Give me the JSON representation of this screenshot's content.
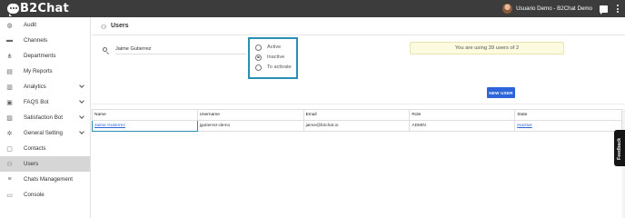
{
  "topbar": {
    "logo_text": "B2Chat",
    "user_name": "Usuario Demo - B2Chat Demo"
  },
  "sidebar": {
    "items": [
      {
        "label": "Audit",
        "icon": "check-circle-icon",
        "glyph": "◍",
        "chevron": false
      },
      {
        "label": "Channels",
        "icon": "chat-bubbles-icon",
        "glyph": "▬",
        "chevron": false
      },
      {
        "label": "Departments",
        "icon": "hierarchy-icon",
        "glyph": "⋔",
        "chevron": false
      },
      {
        "label": "My Reports",
        "icon": "report-icon",
        "glyph": "▤",
        "chevron": false
      },
      {
        "label": "Analytics",
        "icon": "bar-chart-icon",
        "glyph": "▥",
        "chevron": true
      },
      {
        "label": "FAQS Bot",
        "icon": "faq-icon",
        "glyph": "▣",
        "chevron": true
      },
      {
        "label": "Satisfaction Bot",
        "icon": "satisfaction-icon",
        "glyph": "▨",
        "chevron": true
      },
      {
        "label": "General Setting",
        "icon": "gear-icon",
        "glyph": "✲",
        "chevron": true
      },
      {
        "label": "Contacts",
        "icon": "contacts-icon",
        "glyph": "▢",
        "chevron": false
      },
      {
        "label": "Users",
        "icon": "users-icon",
        "glyph": "⚇",
        "chevron": false
      },
      {
        "label": "Chats Management",
        "icon": "chats-management-icon",
        "glyph": "≡",
        "chevron": false
      },
      {
        "label": "Console",
        "icon": "console-icon",
        "glyph": "▭",
        "chevron": false
      }
    ],
    "active": "Users"
  },
  "page": {
    "title": "Users"
  },
  "filters": {
    "search_value": "Jaime Gutierrez",
    "status_options": [
      {
        "label": "Active",
        "checked": false
      },
      {
        "label": "Inactive",
        "checked": true
      },
      {
        "label": "To activate",
        "checked": false
      }
    ]
  },
  "usage": {
    "text": "You are using 39 users of 2"
  },
  "actions": {
    "new_user_label": "NEW USER"
  },
  "table": {
    "columns": [
      "Name",
      "Username",
      "Email",
      "Role",
      "State"
    ],
    "rows": [
      [
        "Jaime Gutierrez",
        "jgutierrez-demo",
        "jaime@b2chat.io",
        "ADMIN",
        "Inactive"
      ]
    ]
  },
  "feedback": {
    "label": "Feedback"
  },
  "colors": {
    "topbar": "#3c3c3c",
    "accent_blue": "#2e64d9",
    "highlight_border": "#2a8fb5",
    "active_nav": "#d6d6d6",
    "usage_bg": "#fdfbdf"
  }
}
